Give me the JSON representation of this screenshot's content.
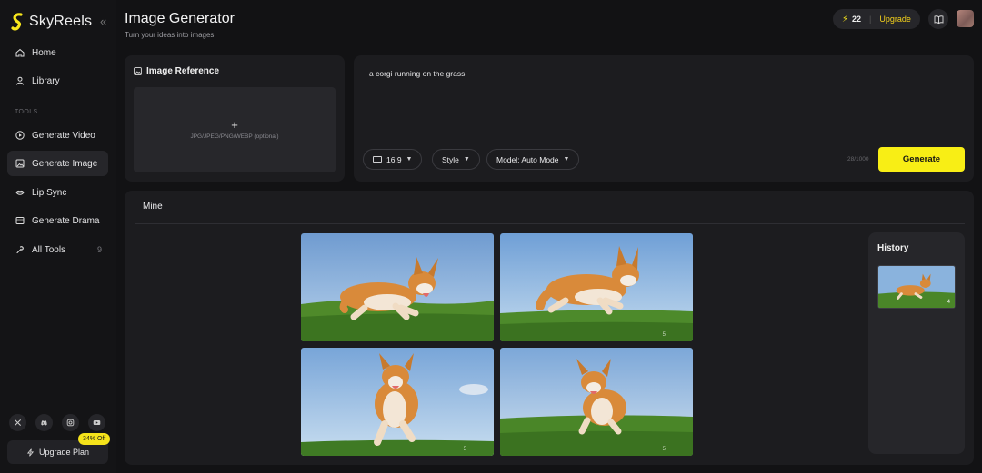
{
  "brand": {
    "name": "SkyReels",
    "accent": "#f8ee15"
  },
  "sidebar": {
    "collapse_icon": "chevrons-left-icon",
    "items_top": [
      {
        "label": "Home",
        "icon": "home-icon"
      },
      {
        "label": "Library",
        "icon": "user-icon"
      }
    ],
    "section_label": "TOOLS",
    "tools": [
      {
        "label": "Generate Video",
        "icon": "play-circle-icon"
      },
      {
        "label": "Generate Image",
        "icon": "image-icon",
        "active": true
      },
      {
        "label": "Lip Sync",
        "icon": "lips-icon"
      },
      {
        "label": "Generate Drama",
        "icon": "film-icon"
      },
      {
        "label": "All Tools",
        "icon": "tools-icon",
        "count": "9"
      }
    ],
    "socials": [
      "x-icon",
      "discord-icon",
      "instagram-icon",
      "youtube-icon"
    ],
    "upgrade_label": "Upgrade Plan",
    "discount_badge": "34% Off"
  },
  "header": {
    "title": "Image Generator",
    "subtitle": "Turn your ideas into images",
    "credits": "22",
    "upgrade_label": "Upgrade"
  },
  "reference": {
    "title": "Image Reference",
    "plus": "+",
    "hint": "JPG/JPEG/PNG/WEBP (optional)"
  },
  "prompt": {
    "text": "a corgi running on the grass",
    "ratio": "16:9",
    "style": "Style",
    "model": "Model: Auto Mode",
    "char_count": "28/1000",
    "generate_label": "Generate"
  },
  "results": {
    "tab_label": "Mine",
    "images": [
      {
        "caption": "corgi running side view",
        "index": ""
      },
      {
        "caption": "corgi leaping on grass",
        "index": "5"
      },
      {
        "caption": "corgi running toward camera",
        "index": "5"
      },
      {
        "caption": "corgi trotting toward camera",
        "index": "5"
      }
    ]
  },
  "history": {
    "title": "History",
    "count": "4"
  }
}
